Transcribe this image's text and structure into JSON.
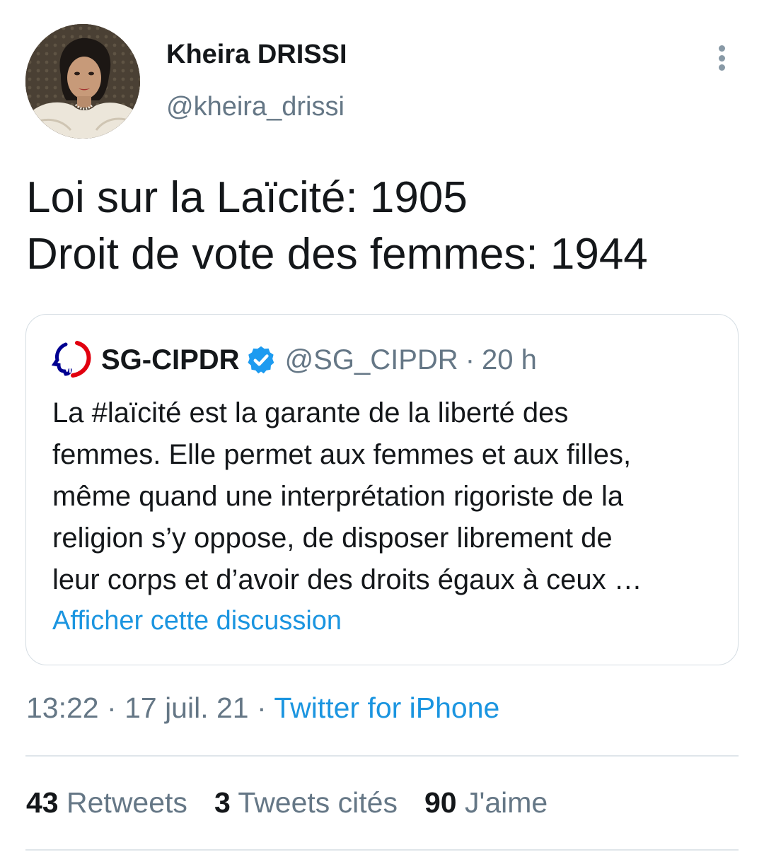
{
  "author": {
    "display_name": "Kheira DRISSI",
    "handle": "@kheira_drissi"
  },
  "tweet": {
    "lines": [
      "Loi sur la Laïcité: 1905",
      "Droit de vote des femmes: 1944"
    ]
  },
  "quoted_tweet": {
    "display_name": "SG-CIPDR",
    "handle": "@SG_CIPDR",
    "separator": "·",
    "time": "20 h",
    "lines": [
      "La #laïcité est la garante de la liberté des",
      "femmes. Elle permet aux femmes et aux filles,",
      "même quand une interprétation rigoriste de la",
      "religion s’y oppose, de disposer librement de",
      "leur corps et d’avoir des droits égaux à ceux …"
    ],
    "link_label": "Afficher cette discussion"
  },
  "meta": {
    "time": "13:22",
    "separator": "·",
    "date": "17 juil. 21",
    "source": "Twitter for iPhone"
  },
  "stats": {
    "retweets_count": "43",
    "retweets_label": "Retweets",
    "quotes_count": "3",
    "quotes_label": "Tweets cités",
    "likes_count": "90",
    "likes_label": "J'aime"
  },
  "colors": {
    "link": "#1b95e0",
    "secondary_text": "#657786",
    "verified": "#1d9bf0"
  },
  "icons": {
    "more": "vertical-ellipsis-icon",
    "verified": "verified-badge-icon",
    "quoted_avatar": "marianne-logo-icon"
  }
}
